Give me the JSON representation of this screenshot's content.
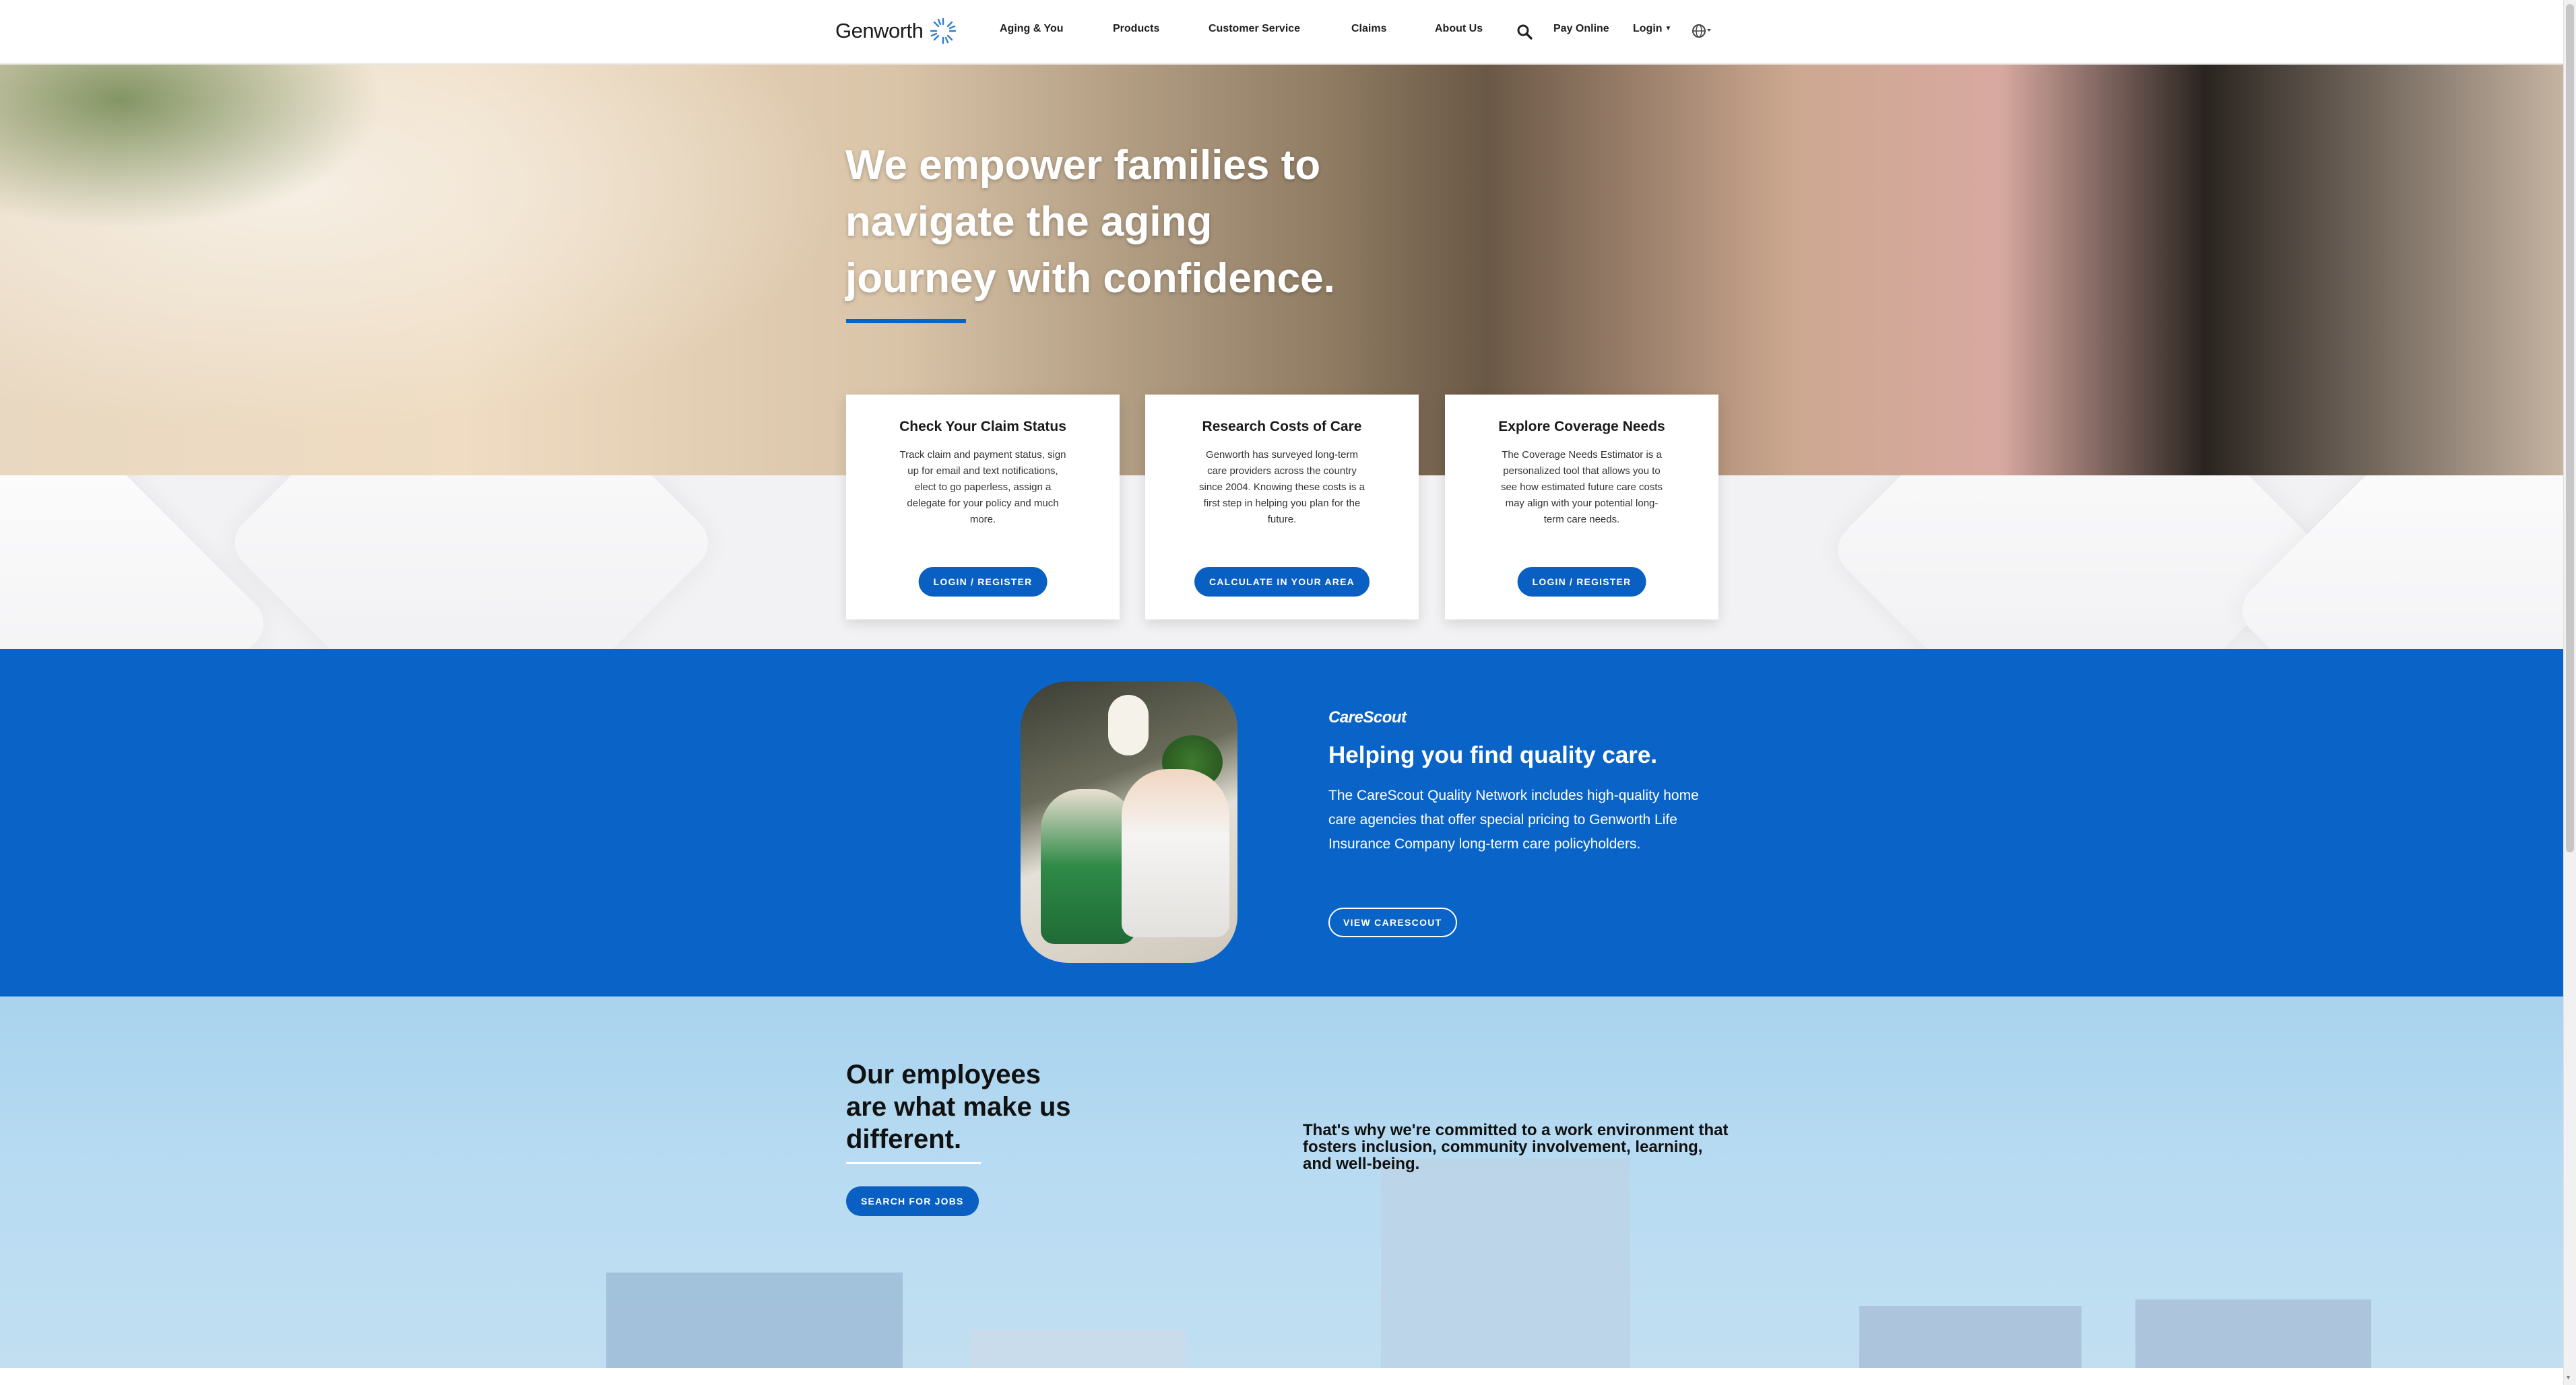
{
  "nav": {
    "logo_text": "Genworth",
    "items": [
      "Aging & You",
      "Products",
      "Customer Service",
      "Claims",
      "About Us"
    ],
    "pay_online": "Pay Online",
    "login": "Login"
  },
  "hero": {
    "title": "We empower families to navigate the aging journey with confidence."
  },
  "cards": [
    {
      "title": "Check Your Claim Status",
      "body": "Track claim and payment status, sign up for email and text notifications, elect to go paperless, assign a delegate for your policy and much more.",
      "button": "LOGIN / REGISTER"
    },
    {
      "title": "Research Costs of Care",
      "body": "Genworth has surveyed long-term care providers across the country since 2004. Knowing these costs is a first step in helping you plan for the future.",
      "button": "CALCULATE IN YOUR AREA"
    },
    {
      "title": "Explore Coverage Needs",
      "body": "The Coverage Needs Estimator is a personalized tool that allows you to see how estimated future care costs may align with your potential long-term care needs.",
      "button": "LOGIN / REGISTER"
    }
  ],
  "carescout": {
    "logo": "CareScout",
    "title": "Helping you find quality care.",
    "body": "The CareScout Quality Network includes high-quality home care agencies that offer special pricing to Genworth Life Insurance Company long-term care policyholders.",
    "button": "VIEW CARESCOUT"
  },
  "employees": {
    "title": "Our employees are what make us different.",
    "button": "SEARCH FOR JOBS",
    "text": "That's why we're committed to a work environment that fosters inclusion, community involvement, learning, and well-being."
  },
  "colors": {
    "brand_blue": "#0a64c8",
    "button_blue": "#0a5fc2",
    "light_blue": "#b7dbf2"
  },
  "icons": [
    "genworth-logo-icon",
    "search-icon",
    "globe-icon",
    "caret-down-icon"
  ]
}
